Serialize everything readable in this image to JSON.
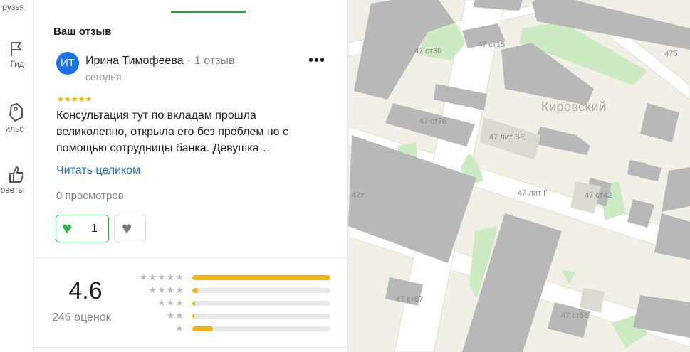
{
  "rail": {
    "items": [
      {
        "label": "рузья",
        "icon": "friends-icon"
      },
      {
        "label": "Гид",
        "icon": "flag-icon"
      },
      {
        "label": "ильё",
        "icon": "tag-icon"
      },
      {
        "label": "оветы",
        "icon": "thumb-up-icon"
      }
    ]
  },
  "review": {
    "section_title": "Ваш отзыв",
    "avatar_initials": "ИТ",
    "author_name": "Ирина Тимофеева",
    "author_sep": "·",
    "author_reviews": "1 отзыв",
    "date": "сегодня",
    "more_label": "•••",
    "rating_stars": 5,
    "text": "Консультация тут по вкладам прошла великолепно, открыла его без проблем но с помощью сотрудницы банка. Девушка…",
    "read_more": "Читать целиком",
    "views": "0 просмотров",
    "likes": "1",
    "like_icon": "green-heart-icon",
    "dislike_icon": "gray-heart-icon"
  },
  "summary": {
    "rating": "4.6",
    "count": "246 оценок",
    "distribution": [
      {
        "stars": 5,
        "fraction": 1.0
      },
      {
        "stars": 4,
        "fraction": 0.04
      },
      {
        "stars": 3,
        "fraction": 0.02
      },
      {
        "stars": 2,
        "fraction": 0.01
      },
      {
        "stars": 1,
        "fraction": 0.15
      }
    ]
  },
  "map": {
    "district": "Кировский",
    "labels": [
      "47 ст30",
      "47 ст15",
      "47б",
      "47 ст76",
      "47 лит БЕ",
      "47т",
      "47 лит Г",
      "47 ст42",
      "47 ст87",
      "47 ст56"
    ]
  },
  "colors": {
    "accent_green": "#1ea83a",
    "link_blue": "#1a73c8",
    "star_yellow": "#f4b400",
    "avatar_blue": "#1a73e8",
    "building_gray": "#b5b5b5",
    "park_green": "#cdebc2"
  }
}
